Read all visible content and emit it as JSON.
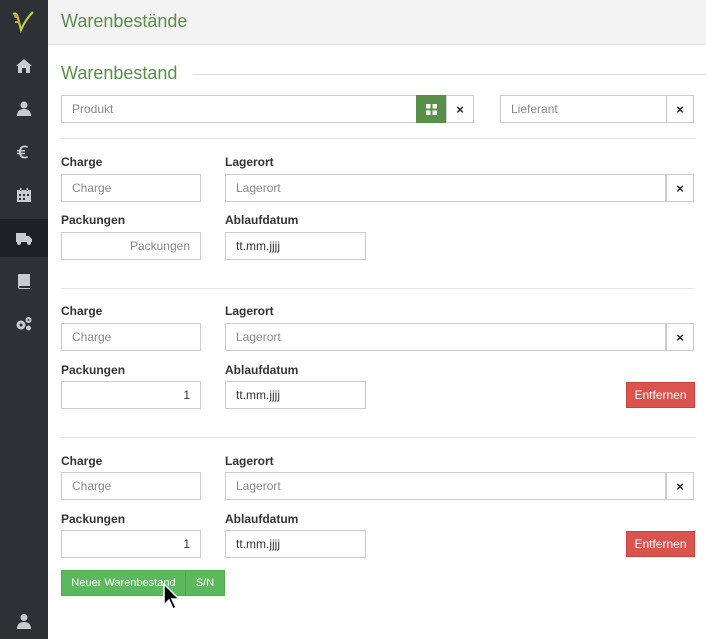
{
  "header": {
    "title": "Warenbestände"
  },
  "section": {
    "title": "Warenbestand"
  },
  "filters": {
    "product_placeholder": "Produkt",
    "supplier_placeholder": "Lieferant",
    "clear_symbol": "×"
  },
  "labels": {
    "batch": "Charge",
    "location": "Lagerort",
    "packages": "Packungen",
    "expiry": "Ablaufdatum"
  },
  "entries": [
    {
      "batch_placeholder": "Charge",
      "location_placeholder": "Lagerort",
      "packages_value": "Packungen",
      "expiry_value": "tt.mm.jjjj"
    },
    {
      "batch_placeholder": "Charge",
      "location_placeholder": "Lagerort",
      "packages_value": "1",
      "expiry_value": "tt.mm.jjjj",
      "remove_label": "Entfernen"
    },
    {
      "batch_placeholder": "Charge",
      "location_placeholder": "Lagerort",
      "packages_value": "1",
      "expiry_value": "tt.mm.jjjj",
      "remove_label": "Entfernen"
    }
  ],
  "actions": {
    "new_stock_label": "Neuer Warenbestand",
    "sn_label": "S/N"
  },
  "sidebar": {
    "icons": [
      "home-icon",
      "users-icon",
      "euro-icon",
      "calendar-icon",
      "truck-icon",
      "book-icon",
      "settings-icon"
    ],
    "active": "truck-icon",
    "bottom_icon": "user-icon"
  },
  "colors": {
    "accent_green": "#5a8f4a",
    "button_green": "#5cb85c",
    "danger_red": "#d9534f",
    "sidebar_bg": "#2d3136"
  }
}
